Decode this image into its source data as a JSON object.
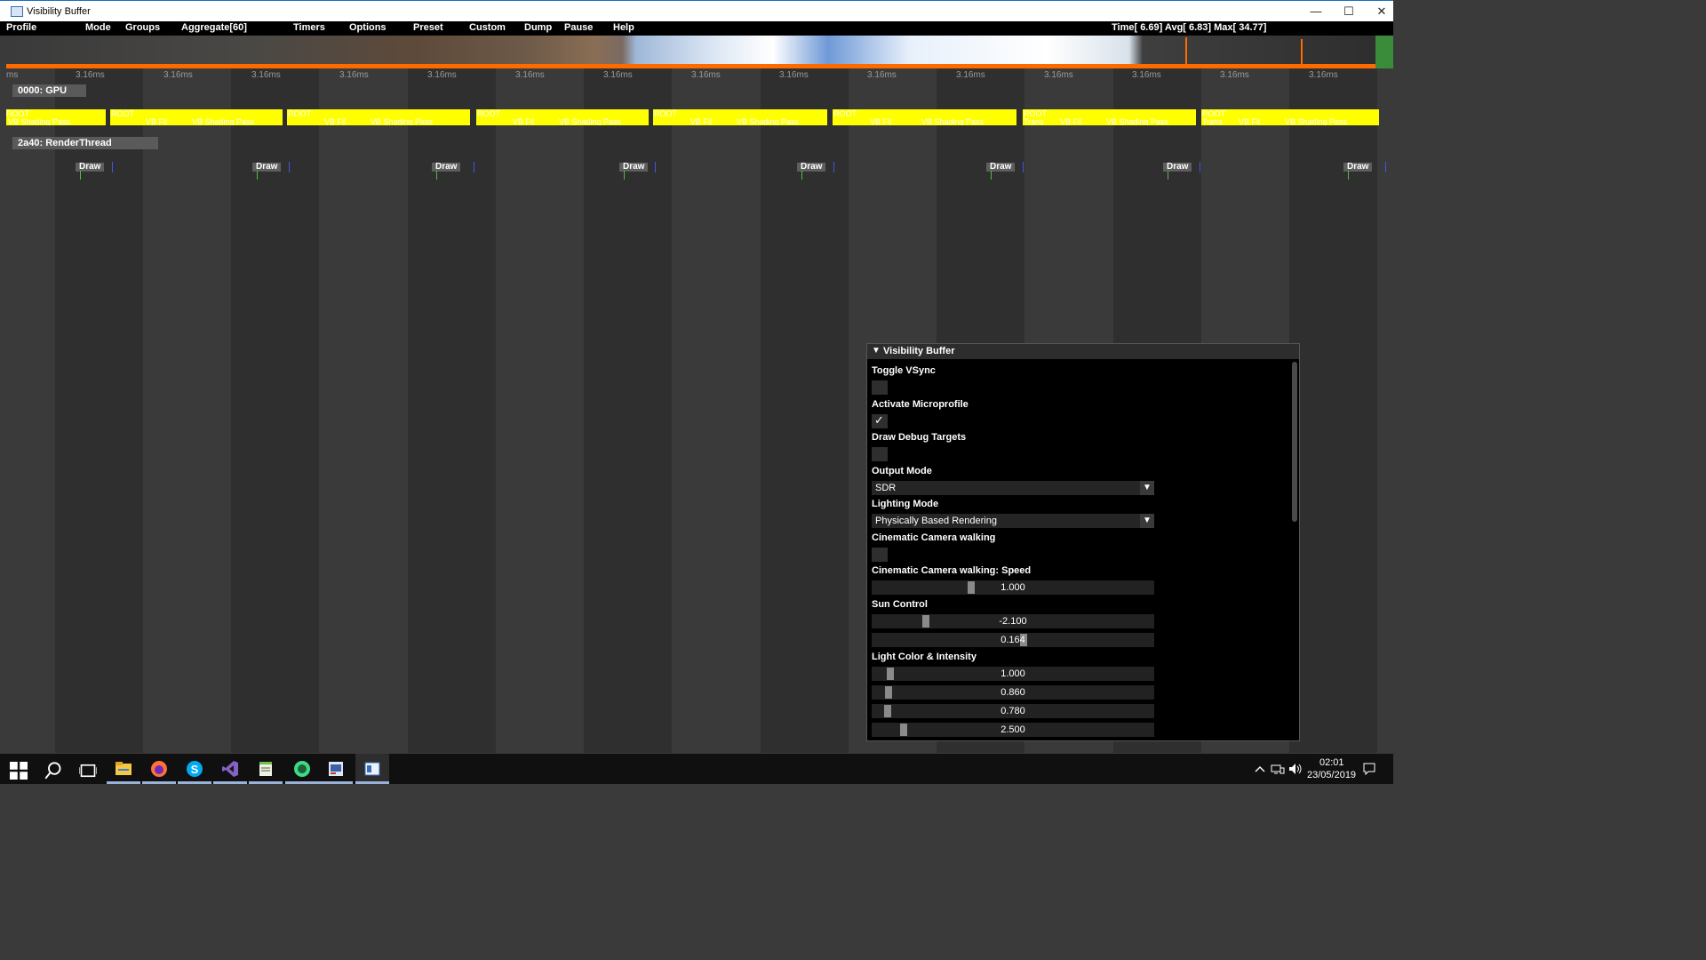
{
  "window": {
    "title": "Visibility Buffer",
    "controls": {
      "minimize": "—",
      "maximize": "☐",
      "close": "✕"
    }
  },
  "menubar": {
    "items": [
      "Profile",
      "Mode",
      "Groups",
      "Aggregate[60]",
      "Timers",
      "Options",
      "Preset",
      "Custom",
      "Dump",
      "Pause",
      "Help"
    ],
    "stats": "Time[  6.69] Avg[  6.83] Max[ 34.77]"
  },
  "timeline": {
    "left_tick": "ms",
    "ticks": [
      "3.16ms",
      "3.16ms",
      "3.16ms",
      "3.16ms",
      "3.16ms",
      "3.16ms",
      "3.16ms",
      "3.16ms",
      "3.16ms",
      "3.16ms",
      "3.16ms",
      "3.16ms",
      "3.16ms",
      "3.16ms",
      "3.16ms"
    ],
    "gpu_label": "0000: GPU",
    "render_thread_label": "2a40: RenderThread",
    "gpu_frames": [
      {
        "root": "ROOT",
        "texts": [
          "VB Shading Pass"
        ]
      },
      {
        "root": "ROOT",
        "texts": [
          "VB Fil",
          "VB Shading Pass"
        ]
      },
      {
        "root": "ROOT",
        "texts": [
          "VB Fil",
          "VB Shading Pass"
        ]
      },
      {
        "root": "ROOT",
        "texts": [
          "VB Fil",
          "VB Shading Pass"
        ]
      },
      {
        "root": "ROOT",
        "texts": [
          "VB Fil",
          "VB Shading Pass"
        ]
      },
      {
        "root": "ROOT",
        "texts": [
          "VB Fil",
          "VB Shading Pass"
        ]
      },
      {
        "root": "ROOT",
        "texts": [
          "Trans",
          "VB Fil",
          "VB Shading Pass"
        ]
      },
      {
        "root": "ROOT",
        "texts": [
          "Trans",
          "VB Fil",
          "VB Shading Pass"
        ]
      }
    ],
    "draw_label": "Draw"
  },
  "panel": {
    "title": "Visibility Buffer",
    "toggle_vsync": {
      "label": "Toggle VSync",
      "checked": false
    },
    "activate_microprofile": {
      "label": "Activate Microprofile",
      "checked": true,
      "mark": "✓"
    },
    "draw_debug_targets": {
      "label": "Draw Debug Targets",
      "checked": false
    },
    "output_mode": {
      "label": "Output Mode",
      "value": "SDR"
    },
    "lighting_mode": {
      "label": "Lighting Mode",
      "value": "Physically Based Rendering"
    },
    "cinematic": {
      "label": "Cinematic Camera walking",
      "checked": false
    },
    "cinematic_speed": {
      "label": "Cinematic Camera walking: Speed",
      "value": "1.000"
    },
    "sun_control": {
      "label": "Sun Control",
      "values": [
        "-2.100",
        "0.164"
      ]
    },
    "light_color": {
      "label": "Light Color & Intensity",
      "values": [
        "1.000",
        "0.860",
        "0.780",
        "2.500"
      ]
    }
  },
  "taskbar": {
    "time": "02:01",
    "date": "23/05/2019",
    "icons": [
      "windows-start-icon",
      "search-icon",
      "task-view-icon",
      "file-explorer-icon",
      "firefox-icon",
      "skype-icon",
      "visual-studio-icon",
      "notepad-icon",
      "android-studio-icon",
      "image-viewer-icon",
      "visibility-buffer-app-icon"
    ],
    "tray_icons": [
      "chevron-up-icon",
      "network-icon",
      "volume-icon",
      "notification-icon"
    ]
  }
}
